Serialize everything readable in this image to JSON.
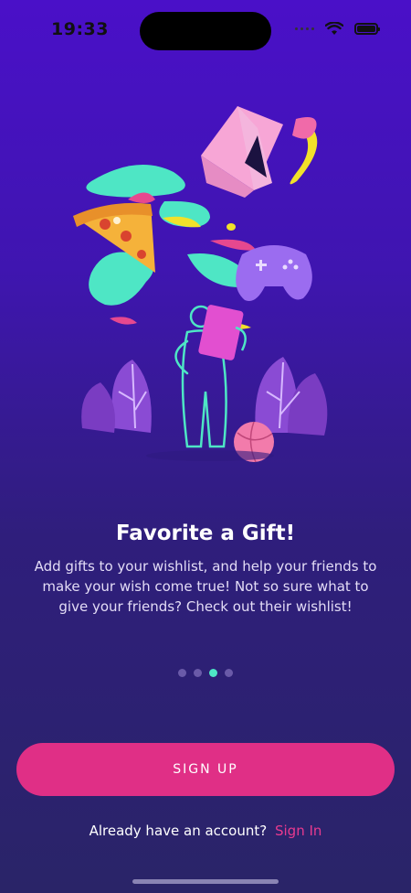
{
  "status_bar": {
    "time": "19:33"
  },
  "onboarding": {
    "title": "Favorite a Gift!",
    "description": "Add gifts to your wishlist, and help your friends to make your wish come true! Not so sure what to give your friends? Check out their wishlist!",
    "page_count": 4,
    "active_page": 3
  },
  "actions": {
    "signup_label": "SIGN UP",
    "have_account_text": "Already have an account?",
    "signin_label": "Sign In"
  },
  "colors": {
    "accent_pink": "#e02f86",
    "active_dot": "#4ee6c5",
    "background_top": "#4a10c8",
    "background_bottom": "#2a2468"
  },
  "icons": {
    "wifi": "wifi-icon",
    "battery": "battery-icon",
    "signal": "signal-dots-icon"
  }
}
